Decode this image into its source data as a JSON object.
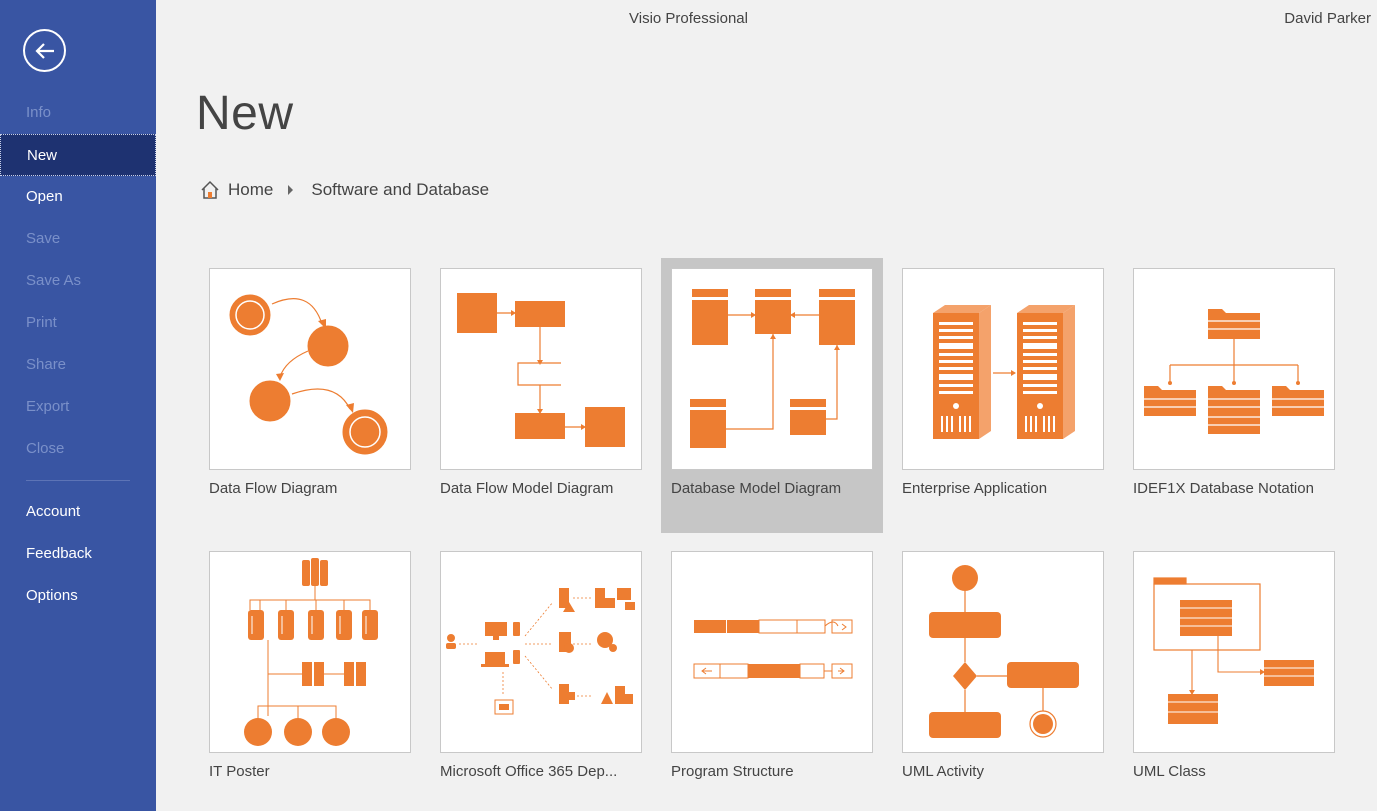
{
  "app": {
    "title": "Visio Professional",
    "user": "David Parker"
  },
  "sidebar": {
    "items": [
      {
        "label": "Info"
      },
      {
        "label": "New"
      },
      {
        "label": "Open"
      },
      {
        "label": "Save"
      },
      {
        "label": "Save As"
      },
      {
        "label": "Print"
      },
      {
        "label": "Share"
      },
      {
        "label": "Export"
      },
      {
        "label": "Close"
      },
      {
        "label": "Account"
      },
      {
        "label": "Feedback"
      },
      {
        "label": "Options"
      }
    ]
  },
  "page": {
    "title": "New"
  },
  "breadcrumb": {
    "home": "Home",
    "current": "Software and Database"
  },
  "colors": {
    "accent": "#ed7d31",
    "sidebar": "#3955a3",
    "sidebar_active": "#1e3271"
  },
  "templates": [
    {
      "label": "Data Flow Diagram"
    },
    {
      "label": "Data Flow Model Diagram"
    },
    {
      "label": "Database Model Diagram"
    },
    {
      "label": "Enterprise Application"
    },
    {
      "label": "IDEF1X Database Notation"
    },
    {
      "label": "IT Poster"
    },
    {
      "label": "Microsoft Office 365 Dep..."
    },
    {
      "label": "Program Structure"
    },
    {
      "label": "UML Activity"
    },
    {
      "label": "UML Class"
    }
  ]
}
